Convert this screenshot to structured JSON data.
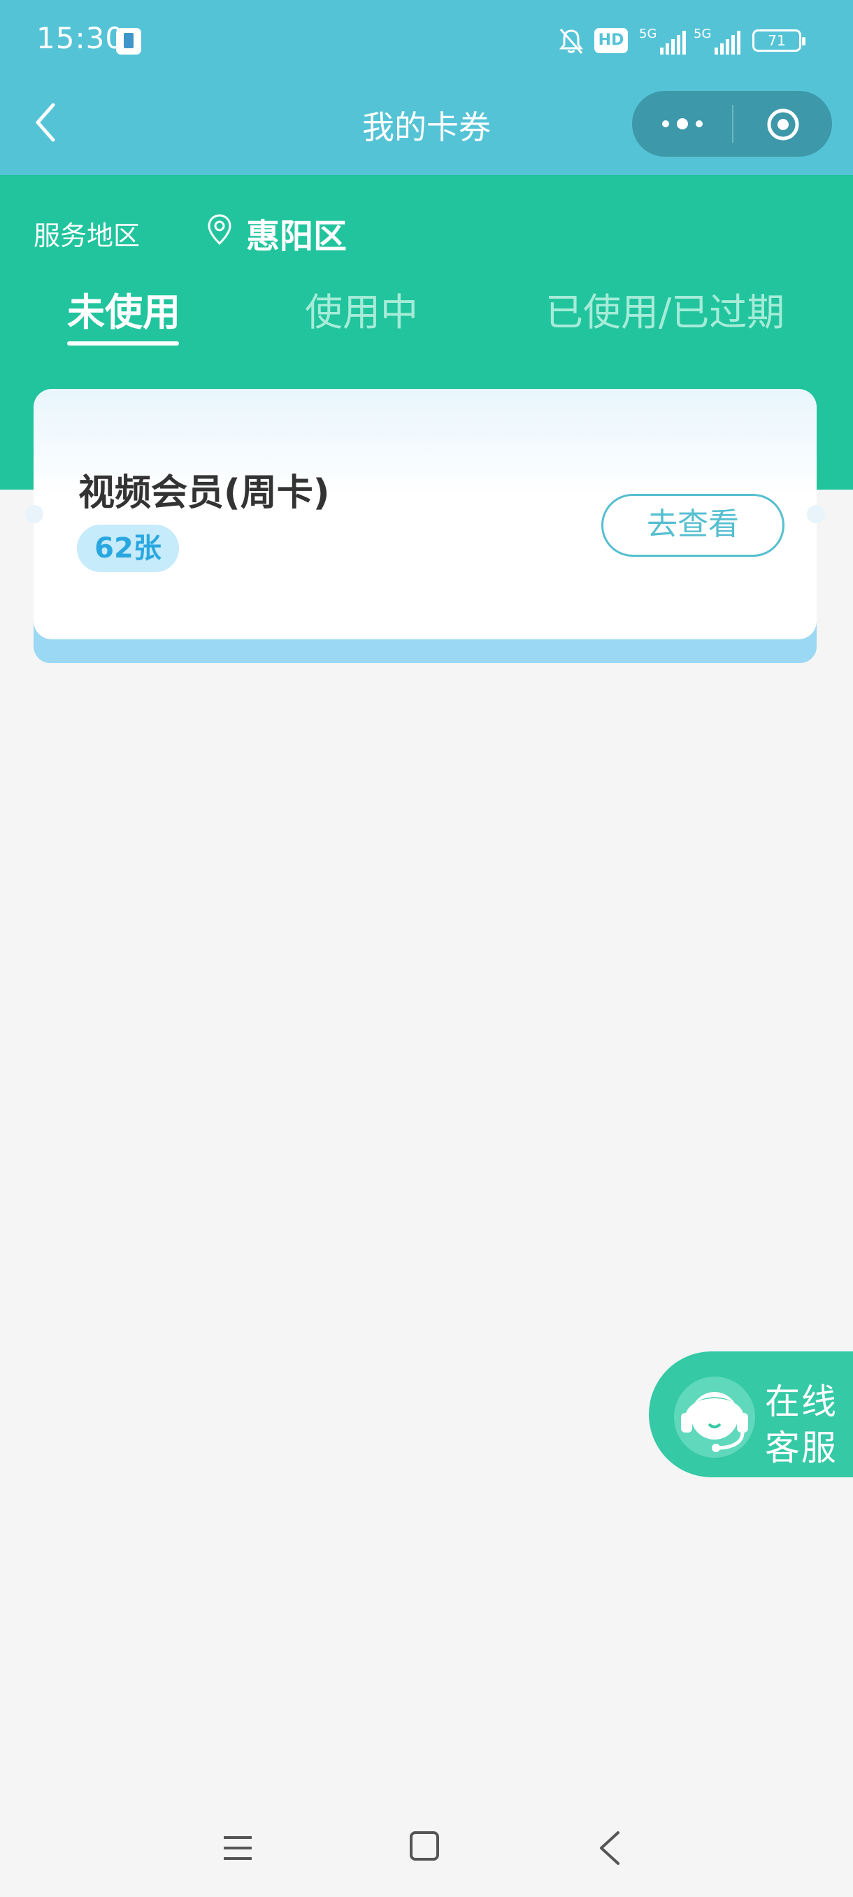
{
  "status_bar": {
    "time": "15:30",
    "hd_label": "HD",
    "signal1_label": "5G",
    "signal2_label": "5G",
    "battery": "71"
  },
  "nav": {
    "title": "我的卡券",
    "icons": [
      "back-icon",
      "more-icon",
      "target-icon"
    ]
  },
  "region": {
    "label": "服务地区",
    "value": "惠阳区"
  },
  "tabs": [
    {
      "label": "未使用",
      "active": true
    },
    {
      "label": "使用中",
      "active": false
    },
    {
      "label": "已使用/已过期",
      "active": false
    }
  ],
  "card": {
    "title": "视频会员(周卡)",
    "count": "62张",
    "button_label": "去查看"
  },
  "service": {
    "line1": "在线",
    "line2": "客服"
  },
  "colors": {
    "header_blue": "#55c3d6",
    "header_green": "#22c49d",
    "accent": "#55bfd0"
  }
}
